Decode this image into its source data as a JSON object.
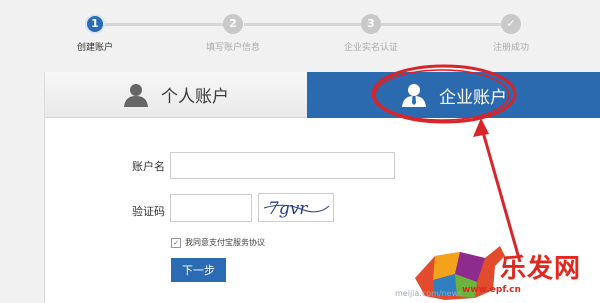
{
  "steps": [
    {
      "number": "1",
      "label": "创建账户",
      "active": true
    },
    {
      "number": "2",
      "label": "填写账户信息",
      "active": false
    },
    {
      "number": "3",
      "label": "企业实名认证",
      "active": false
    },
    {
      "number": "✓",
      "label": "注册成功",
      "active": false
    }
  ],
  "tabs": {
    "personal": {
      "label": "个人账户",
      "icon": "user-icon"
    },
    "enterprise": {
      "label": "企业账户",
      "icon": "business-user-icon",
      "selected": true
    }
  },
  "form": {
    "account_label": "账户名",
    "account_value": "",
    "captcha_label": "验证码",
    "captcha_value": "",
    "captcha_image_text": "7gvr",
    "agree_text": "我同意支付宝服务协议",
    "agree_checked": true,
    "next_label": "下一步"
  },
  "watermark": {
    "title": "乐发网",
    "url": "www.epf.cn",
    "url2": "meijia.com/news"
  },
  "colors": {
    "brand_blue": "#2b6aae",
    "annotation_red": "#d8242b"
  }
}
